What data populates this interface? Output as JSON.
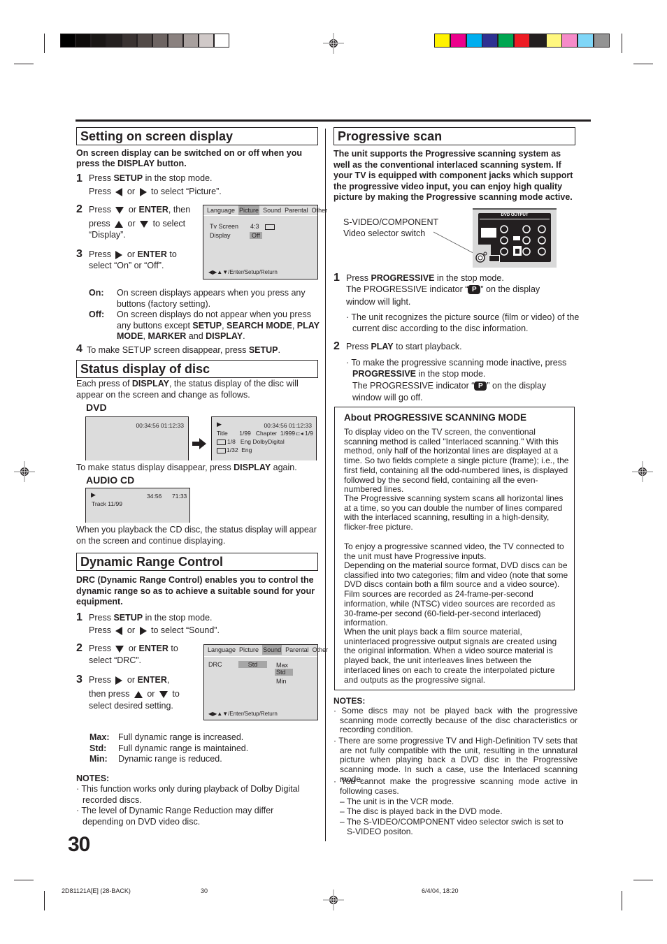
{
  "print_marks": {
    "grayscale": [
      "#000000",
      "#0e0c0b",
      "#1a1716",
      "#252120",
      "#3a3332",
      "#524a48",
      "#6d6462",
      "#8a817f",
      "#a8a09e",
      "#d0c9c8",
      "#ffffff"
    ],
    "colors": [
      "#fff200",
      "#ec008c",
      "#00aeef",
      "#2e3192",
      "#00a651",
      "#ed1c24",
      "#231f20",
      "#fff77f",
      "#f58bc8",
      "#7fd6f7",
      "#939393"
    ]
  },
  "left": {
    "osd_section": {
      "title": "Setting on screen display",
      "intro": "On screen display can be switched on or off when you press the DISPLAY button.",
      "steps": [
        {
          "num": "1",
          "line1_pre": "Press ",
          "line1_bold": "SETUP",
          "line1_post": " in the stop mode.",
          "line2_pre": "Press ",
          "line2_mid": " or ",
          "line2_post": " to select “Picture”."
        },
        {
          "num": "2",
          "line1_pre": "Press ",
          "line1_mid": " or ",
          "line1_bold": "ENTER",
          "line1_post": ", then",
          "line2_pre": "press ",
          "line2_mid": " or ",
          "line2_post": " to select",
          "line3": "“Display”."
        },
        {
          "num": "3",
          "line1_pre": "Press ",
          "line1_mid": " or ",
          "line1_bold": "ENTER",
          "line1_post": " to",
          "line2": "select “On” or “Off”."
        },
        {
          "num": "4",
          "text_pre": "To make SETUP screen disappear, press ",
          "text_bold": "SETUP",
          "text_post": "."
        }
      ],
      "on_label": "On:",
      "on_text": "On screen displays appears when you press any buttons (factory setting).",
      "off_label": "Off:",
      "off_text_pre": "On screen displays do not appear when you press any buttons except ",
      "off_b1": "SETUP",
      "off_sep1": ", ",
      "off_b2": "SEARCH MODE",
      "off_sep2": ", ",
      "off_b3": "PLAY MODE",
      "off_sep3": ", ",
      "off_b4": "MARKER",
      "off_sep4": " and ",
      "off_b5": "DISPLAY",
      "off_end": ".",
      "osd_screen": {
        "tabs": [
          "Language",
          "Picture",
          "Sound",
          "Parental",
          "Other"
        ],
        "selected_tab": "Picture",
        "rows": [
          {
            "label": "Tv Screen",
            "value": "4:3"
          },
          {
            "label": "Display",
            "value": "Off"
          }
        ],
        "footer": "◀▶▲▼/Enter/Setup/Return"
      }
    },
    "status_section": {
      "title": "Status display of disc",
      "intro_pre": "Each press of ",
      "intro_bold": "DISPLAY",
      "intro_post": ", the status display of the disc will appear on the screen and change as follows.",
      "dvd_label": "DVD",
      "dvd_screen1": {
        "times": "00:34:56   01:12:33"
      },
      "dvd_screen2": {
        "play": "▶",
        "times": "00:34:56 01:12:33",
        "row1": "Title       1/99   Chapter  1/999",
        "angle": "1/9",
        "row2": "1/8   Eng DolbyDigital",
        "row3": "1/32  Eng"
      },
      "disappear_pre": "To make status display disappear, press ",
      "disappear_bold": "DISPLAY",
      "disappear_post": " again.",
      "cd_label": "AUDIO CD",
      "cd_screen": {
        "play": "▶",
        "time1": "34:56",
        "time2": "71:33",
        "track": "Track 11/99"
      },
      "cd_text": "When you playback the CD disc, the status display will appear on the screen and continue displaying."
    },
    "drc_section": {
      "title": "Dynamic Range Control",
      "intro": "DRC (Dynamic Range Control) enables you to control the dynamic range so as to achieve a suitable sound for your equipment.",
      "steps": [
        {
          "num": "1",
          "line1_pre": "Press ",
          "line1_bold": "SETUP",
          "line1_post": " in the stop mode.",
          "line2_pre": "Press ",
          "line2_mid": " or ",
          "line2_post": " to select “Sound”."
        },
        {
          "num": "2",
          "line1_pre": "Press ",
          "line1_mid": " or ",
          "line1_bold": "ENTER",
          "line1_post": " to",
          "line2": "select “DRC”."
        },
        {
          "num": "3",
          "line1_pre": "Press ",
          "line1_mid": " or ",
          "line1_bold": "ENTER",
          "line1_post": ",",
          "line2_pre": "then press ",
          "line2_mid": " or ",
          "line2_post": " to",
          "line3": "select desired setting."
        }
      ],
      "osd_screen": {
        "tabs": [
          "Language",
          "Picture",
          "Sound",
          "Parental",
          "Other"
        ],
        "selected_tab": "Sound",
        "label": "DRC",
        "value": "Std",
        "options": [
          "Max",
          "Std",
          "Min"
        ],
        "selected_option": "Std",
        "footer": "◀▶▲▼/Enter/Setup/Return"
      },
      "definitions": [
        {
          "term": "Max:",
          "desc": "Full dynamic range is increased."
        },
        {
          "term": "Std:",
          "desc": "Full dynamic range is maintained."
        },
        {
          "term": "Min:",
          "desc": "Dynamic range is reduced."
        }
      ],
      "notes_title": "NOTES:",
      "notes": [
        "This function works only during playback of Dolby Digital recorded discs.",
        "The level of Dynamic Range Reduction may differ depending on DVD video disc."
      ]
    }
  },
  "right": {
    "progressive_section": {
      "title": "Progressive scan",
      "intro": "The unit supports the Progressive scanning system as well as the conventional interlaced scanning system. If your TV is equipped with component jacks which support the progressive video input, you can enjoy high quality picture by making the Progressive scanning mode active.",
      "callout_line1": "S-VIDEO/COMPONENT",
      "callout_line2": "Video selector switch",
      "panel_title": "DVD OUTPUT",
      "steps": [
        {
          "num": "1",
          "line1_pre": "Press ",
          "line1_bold": "PROGRESSIVE",
          "line1_post": " in the stop mode.",
          "line2_pre": "The PROGRESSIVE indicator “",
          "line2_icon": "P",
          "line2_post": "” on the display",
          "line3": "window will light.",
          "bullet": "The unit recognizes the picture source (film or video) of the current disc according to the disc information."
        },
        {
          "num": "2",
          "line1_pre": "Press ",
          "line1_bold": "PLAY",
          "line1_post": " to start playback.",
          "bullet_pre": "To make the progressive scanning mode inactive, press ",
          "bullet_bold": "PROGRESSIVE",
          "bullet_post": " in the stop mode.",
          "bullet_l3_pre": "The PROGRESSIVE indicator “",
          "bullet_l3_icon": "P",
          "bullet_l3_post": "” on the display",
          "bullet_l4": "window will go off."
        }
      ],
      "about": {
        "title": "About PROGRESSIVE SCANNING MODE",
        "para1": "To display video on the TV screen, the conventional scanning method is called \"Interlaced scanning.\" With this method, only half of the horizontal lines are displayed at a time. So two fields complete a single picture (frame); i.e., the first field, containing all the odd-numbered lines, is displayed followed by the second field, containing all the even-numbered lines.",
        "para2": "The Progressive scanning system scans all horizontal lines at a time, so you can double the number of lines compared with the interlaced scanning, resulting in a high-density, flicker-free picture.",
        "para3": "To enjoy a progressive scanned video, the TV connected to the unit must have Progressive inputs.",
        "para4": "Depending on the material source format, DVD discs can be classified into two categories; film and video (note that some DVD discs contain both a film source and a video source). Film sources are recorded as 24-frame-per-second information, while (NTSC) video sources are recorded as 30-frame-per second (60-field-per-second interlaced) information.",
        "para5": "When the unit plays back a film source material, uninterlaced progressive output signals are created using the original information. When a video source material is played back, the unit interleaves lines between the interlaced lines on each to create the interpolated picture and outputs as the progressive signal."
      },
      "notes_title": "NOTES:",
      "notes": [
        "Some discs may not be played back with the progressive scanning mode correctly because of the disc characteristics or recording condition.",
        "There are some progressive TV and High-Definition TV sets that are not fully compatible with the unit, resulting in the unnatural picture when playing back a DVD disc in the Progressive scanning mode. In such a case, use the Interlaced scanning mode.",
        "You cannot make the progressive scanning mode active in following cases."
      ],
      "sub_notes": [
        "– The unit is in the VCR mode.",
        "– The disc is played back in the DVD mode.",
        "– The S-VIDEO/COMPONENT video selector swich is set to S-VIDEO positon."
      ]
    }
  },
  "page_number": "30",
  "footer": {
    "doc_code": "2D81121A[E] (28-BACK)",
    "page": "30",
    "date": "6/4/04, 18:20"
  }
}
